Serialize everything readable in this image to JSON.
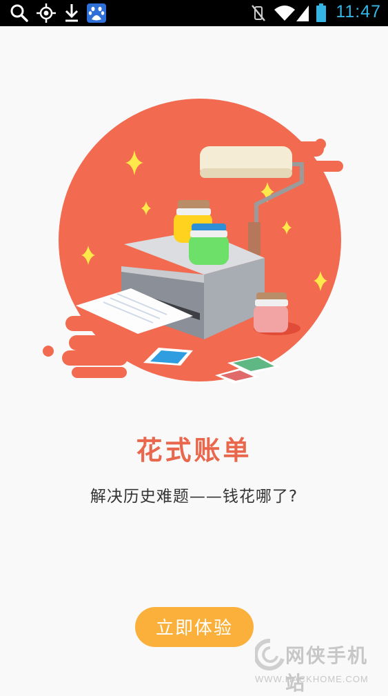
{
  "status_bar": {
    "icons": [
      "search-icon",
      "gps-icon",
      "download-icon",
      "baidu-app-icon",
      "vibrate-icon",
      "wifi-icon",
      "signal-icon",
      "battery-icon"
    ],
    "time": "11:47"
  },
  "main": {
    "title": "花式账单",
    "subtitle": "解决历史难题——钱花哪了?",
    "cta_label": "立即体验"
  },
  "watermark": {
    "name": "网侠手机站",
    "url": "WWW.HACKHOME.COM"
  },
  "colors": {
    "accent_title": "#e9674c",
    "blob": "#f26a4f",
    "button": "#fbb03b",
    "clock": "#33b5e5"
  }
}
